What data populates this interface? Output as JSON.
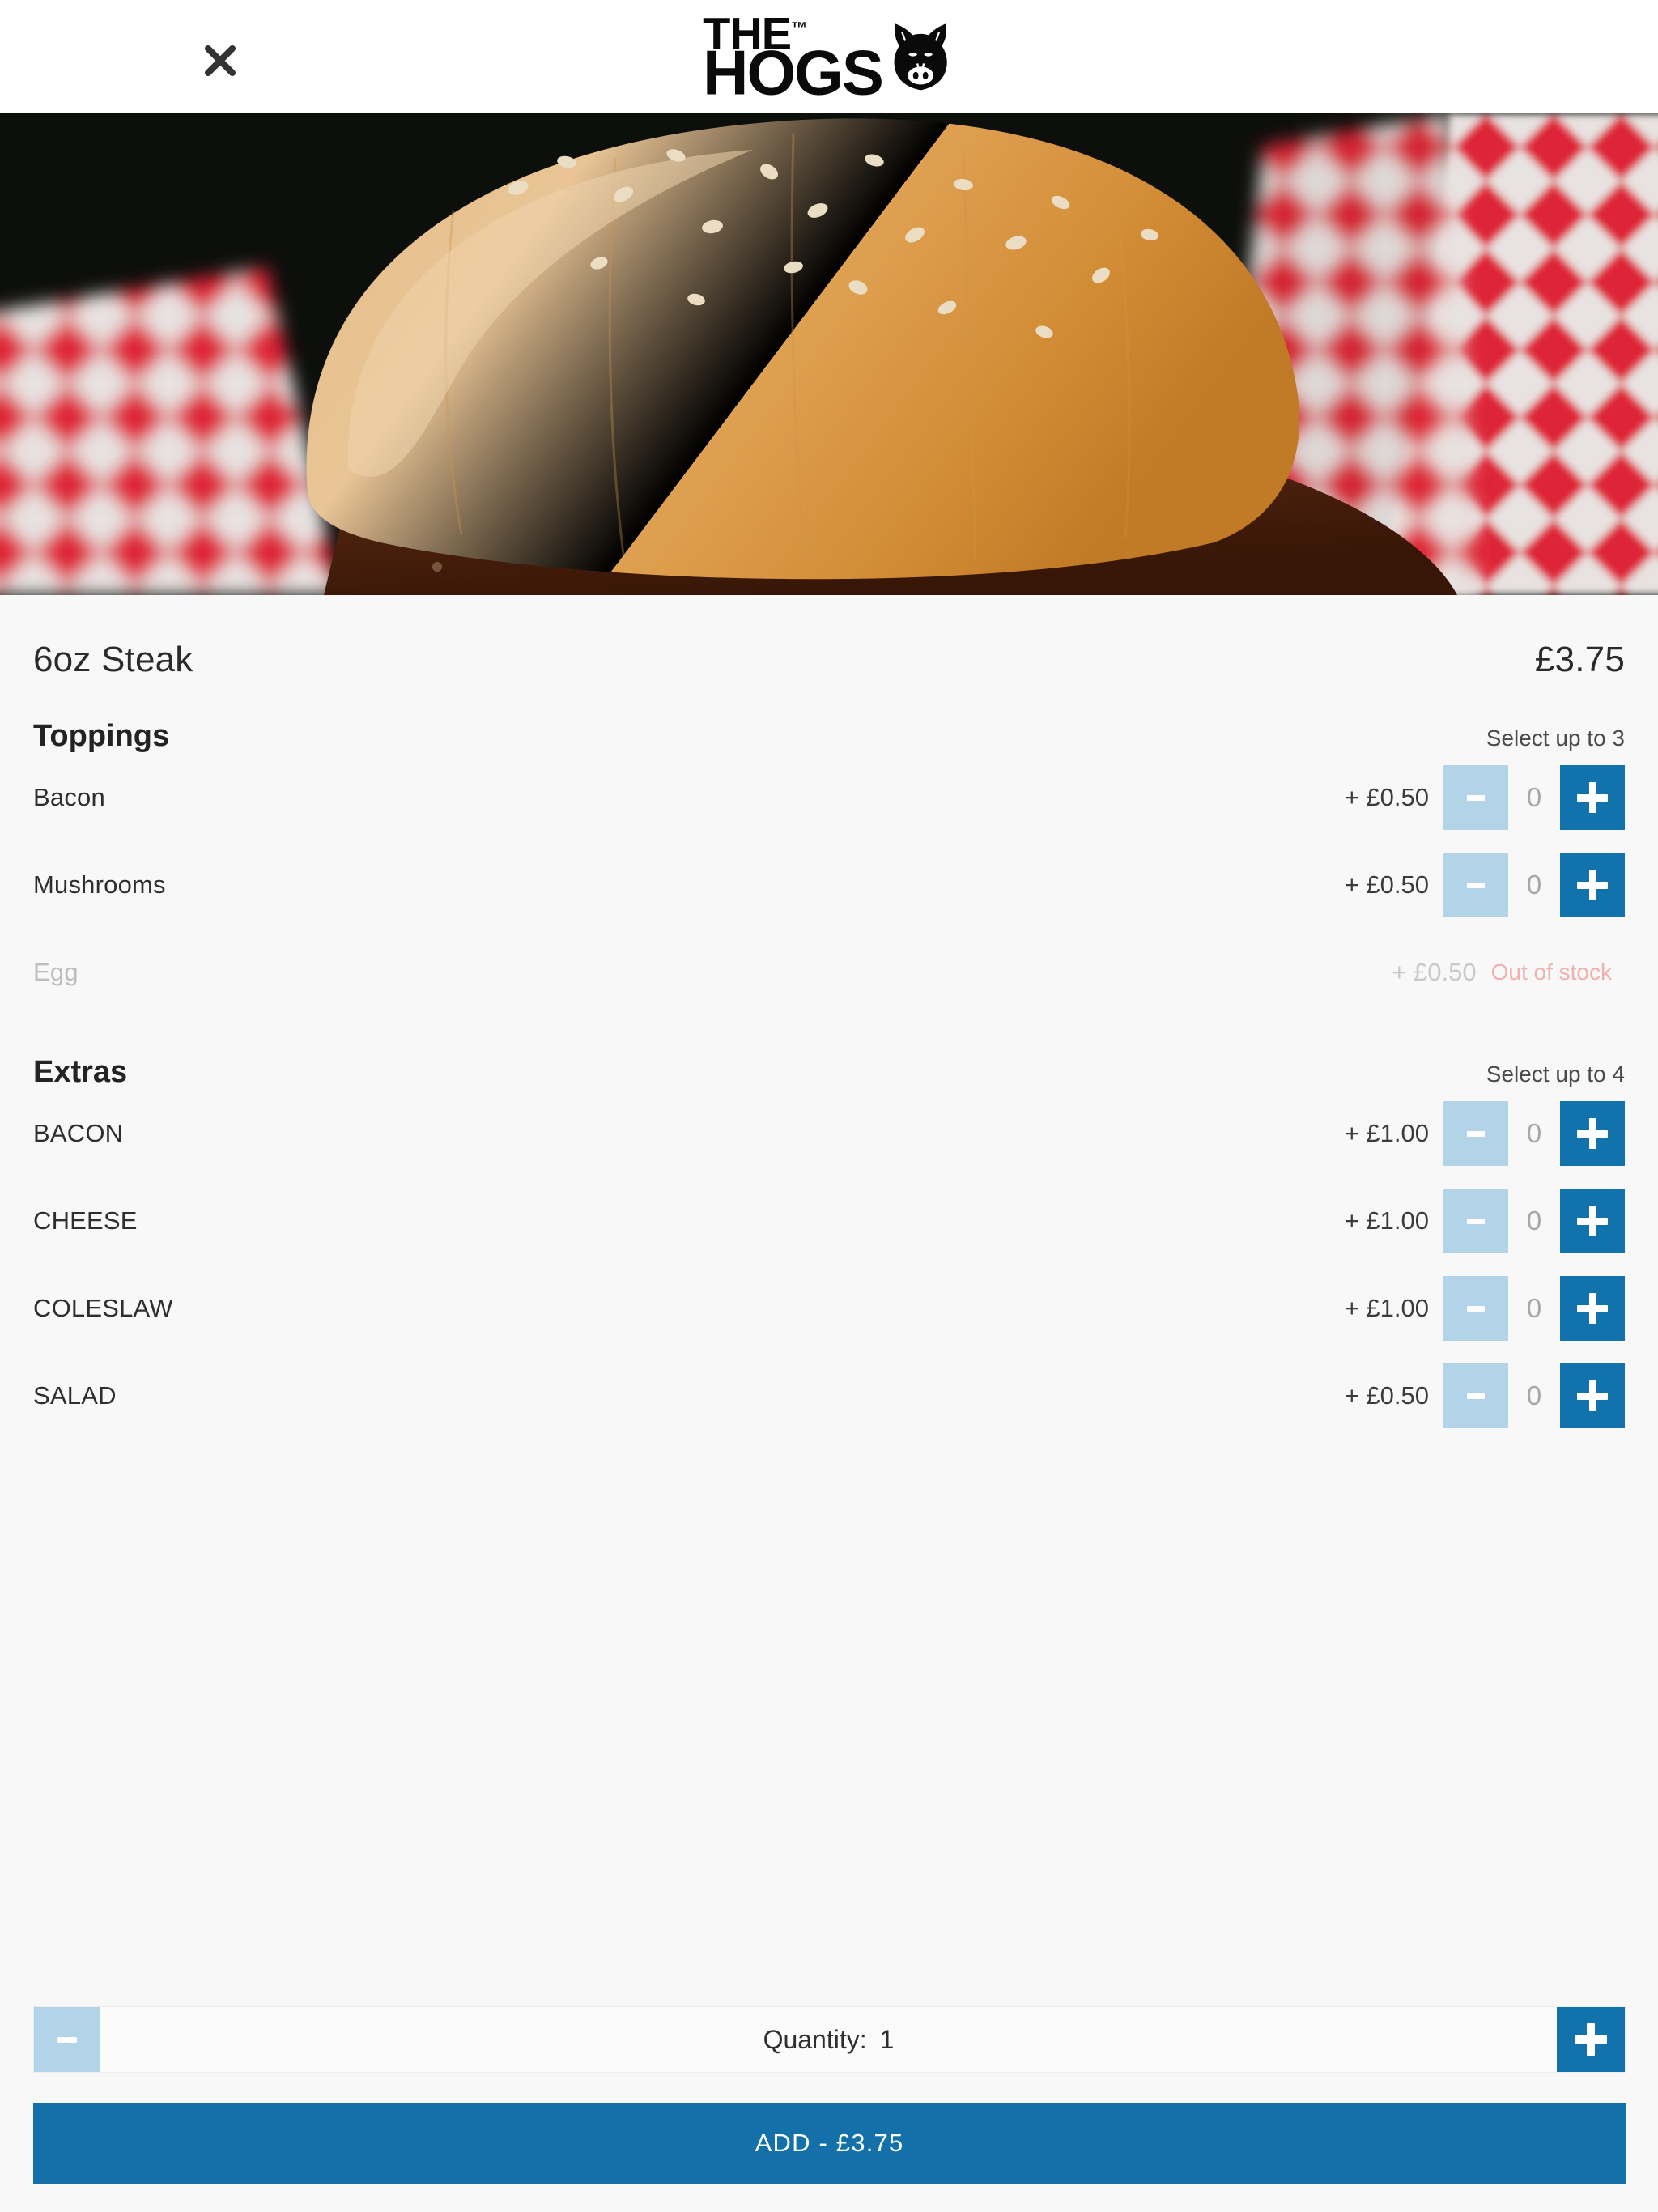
{
  "header": {
    "close_icon": "close-icon",
    "logo": {
      "line1": "THE",
      "tm": "™",
      "line2": "HOGS",
      "mark": "hog-head-icon"
    }
  },
  "hero": {
    "alt": "burger-bun-in-red-checkered-basket"
  },
  "product": {
    "title": "6oz Steak",
    "price": "£3.75"
  },
  "sections": [
    {
      "title": "Toppings",
      "hint": "Select up to 3",
      "options": [
        {
          "name": "Bacon",
          "price": "+ £0.50",
          "count": "0",
          "available": true,
          "minus": "−",
          "plus": "+"
        },
        {
          "name": "Mushrooms",
          "price": "+ £0.50",
          "count": "0",
          "available": true,
          "minus": "−",
          "plus": "+"
        },
        {
          "name": "Egg",
          "price": "+ £0.50",
          "count": "",
          "available": false,
          "status": "Out of stock"
        }
      ]
    },
    {
      "title": "Extras",
      "hint": "Select up to 4",
      "options": [
        {
          "name": "BACON",
          "price": "+ £1.00",
          "count": "0",
          "available": true,
          "minus": "−",
          "plus": "+"
        },
        {
          "name": "CHEESE",
          "price": "+ £1.00",
          "count": "0",
          "available": true,
          "minus": "−",
          "plus": "+"
        },
        {
          "name": "COLESLAW",
          "price": "+ £1.00",
          "count": "0",
          "available": true,
          "minus": "−",
          "plus": "+"
        },
        {
          "name": "SALAD",
          "price": "+ £0.50",
          "count": "0",
          "available": true,
          "minus": "−",
          "plus": "+"
        }
      ]
    }
  ],
  "quantity": {
    "label": "Quantity:",
    "value": "1",
    "minus": "−",
    "plus": "+"
  },
  "footer": {
    "add_label": "ADD  -  £3.75"
  },
  "colors": {
    "accent_blue": "#1272ac",
    "add_blue": "#1370a8",
    "minus_blue": "#b3d4e8",
    "out_of_stock": "#f0b1ae",
    "page_bg": "#f8f8f8",
    "text": "#2e2e2e"
  }
}
